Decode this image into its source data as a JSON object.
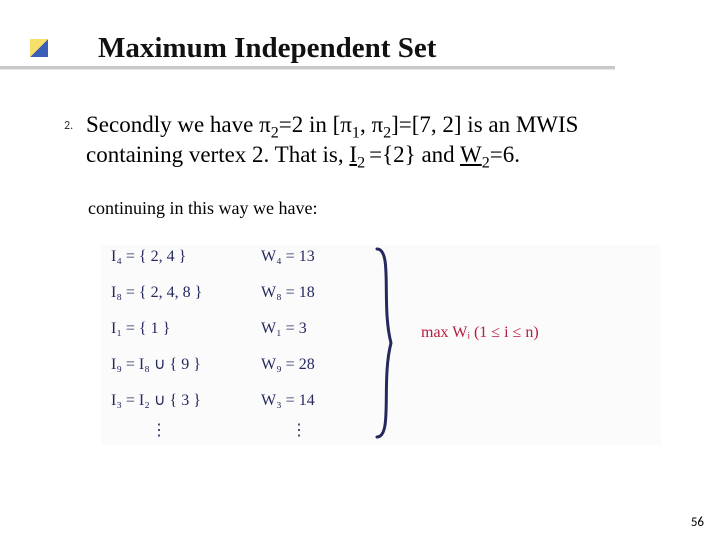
{
  "title": "Maximum Independent Set",
  "item_number": "2.",
  "item_pre": "Secondly we have π",
  "item_sub1": "2",
  "item_mid1": "=2 in [π",
  "item_sub2": "1",
  "item_mid2": ", π",
  "item_sub3": "2",
  "item_mid3": "]=[7, 2] is an MWIS containing vertex 2. That is, ",
  "item_I": "I",
  "item_Isub": "2 ",
  "item_mid4": "={2} and ",
  "item_W": "W",
  "item_Wsub": "2",
  "item_end": "=6.",
  "continuing": "continuing in this way we have:",
  "hand": {
    "i4": "I₄ = { 2, 4 }",
    "w4": "W₄ = 13",
    "i8": "I₈ = { 2, 4, 8 }",
    "w8": "W₈ = 18",
    "i1": "I₁ = { 1 }",
    "w1": "W₁ = 3",
    "i9": "I₉ = I₈ ∪ { 9 }",
    "w9": "W₉ = 28",
    "i3": "I₃ = I₂ ∪ { 3 }",
    "w3": "W₃ = 14",
    "dots1": "⋮",
    "dots2": "⋮",
    "max": "max  Wᵢ   (1 ≤ i ≤ n)"
  },
  "page": "56"
}
